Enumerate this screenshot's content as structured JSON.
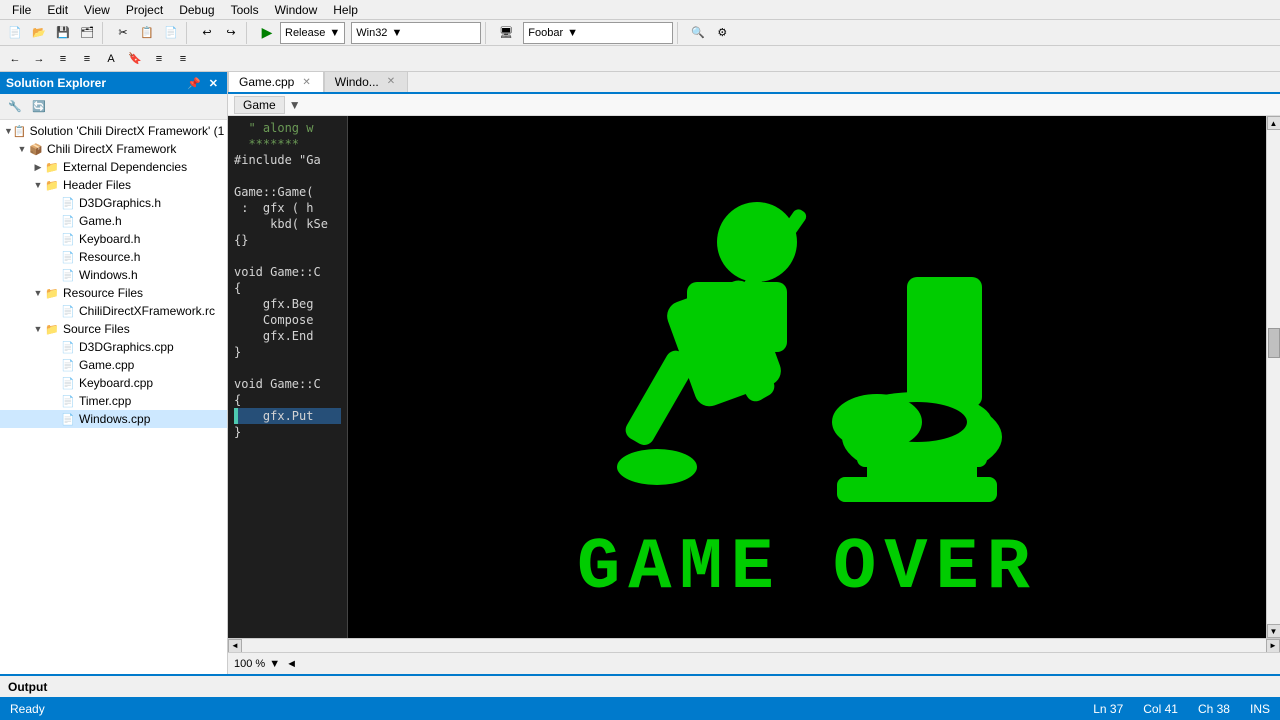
{
  "menubar": {
    "items": [
      "File",
      "Edit",
      "View",
      "Project",
      "Debug",
      "Tools",
      "Window",
      "Help"
    ]
  },
  "toolbar": {
    "build_config": "Release",
    "platform": "Win32",
    "project": "Foobar",
    "run_label": "▶"
  },
  "solution_explorer": {
    "title": "Solution Explorer",
    "root": "Solution 'Chili DirectX Framework' (1",
    "project": "Chili DirectX Framework",
    "folders": [
      {
        "name": "External Dependencies",
        "icon": "📁",
        "items": []
      },
      {
        "name": "Header Files",
        "icon": "📁",
        "items": [
          "D3DGraphics.h",
          "Game.h",
          "Keyboard.h",
          "Resource.h",
          "Windows.h"
        ]
      },
      {
        "name": "Resource Files",
        "icon": "📁",
        "items": [
          "ChiliDirectXFramework.rc"
        ]
      },
      {
        "name": "Source Files",
        "icon": "📁",
        "items": [
          "D3DGraphics.cpp",
          "Game.cpp",
          "Keyboard.cpp",
          "Timer.cpp",
          "Windows.cpp"
        ]
      }
    ]
  },
  "tabs": [
    {
      "label": "Game.cpp",
      "active": true
    },
    {
      "label": "Windo...",
      "active": false
    }
  ],
  "nav_dropdown": "Game",
  "code_lines": [
    {
      "text": "   along w",
      "type": "comment"
    },
    {
      "text": "   *******",
      "type": "comment"
    },
    {
      "text": "#include \"Ga",
      "type": "normal"
    },
    {
      "text": "",
      "type": "normal"
    },
    {
      "text": "Game::Game(",
      "type": "normal"
    },
    {
      "text": "  :  gfx ( h",
      "type": "normal"
    },
    {
      "text": "     kbd( kSe",
      "type": "normal"
    },
    {
      "text": "{}",
      "type": "normal"
    },
    {
      "text": "",
      "type": "normal"
    },
    {
      "text": "void Game::C",
      "type": "normal"
    },
    {
      "text": "{",
      "type": "normal"
    },
    {
      "text": "    gfx.Beg",
      "type": "normal"
    },
    {
      "text": "    Compose",
      "type": "normal"
    },
    {
      "text": "    gfx.End",
      "type": "normal"
    },
    {
      "text": "}",
      "type": "normal"
    },
    {
      "text": "",
      "type": "normal"
    },
    {
      "text": "void Game::C",
      "type": "normal"
    },
    {
      "text": "{",
      "type": "normal"
    },
    {
      "text": "    gfx.Put",
      "type": "highlight"
    },
    {
      "text": "}",
      "type": "normal"
    }
  ],
  "bottom": {
    "zoom": "100 %",
    "output_label": "Output"
  },
  "statusbar": {
    "ready": "Ready",
    "ln": "Ln 37",
    "col": "Col 41",
    "ch": "Ch 38",
    "ins": "INS"
  }
}
